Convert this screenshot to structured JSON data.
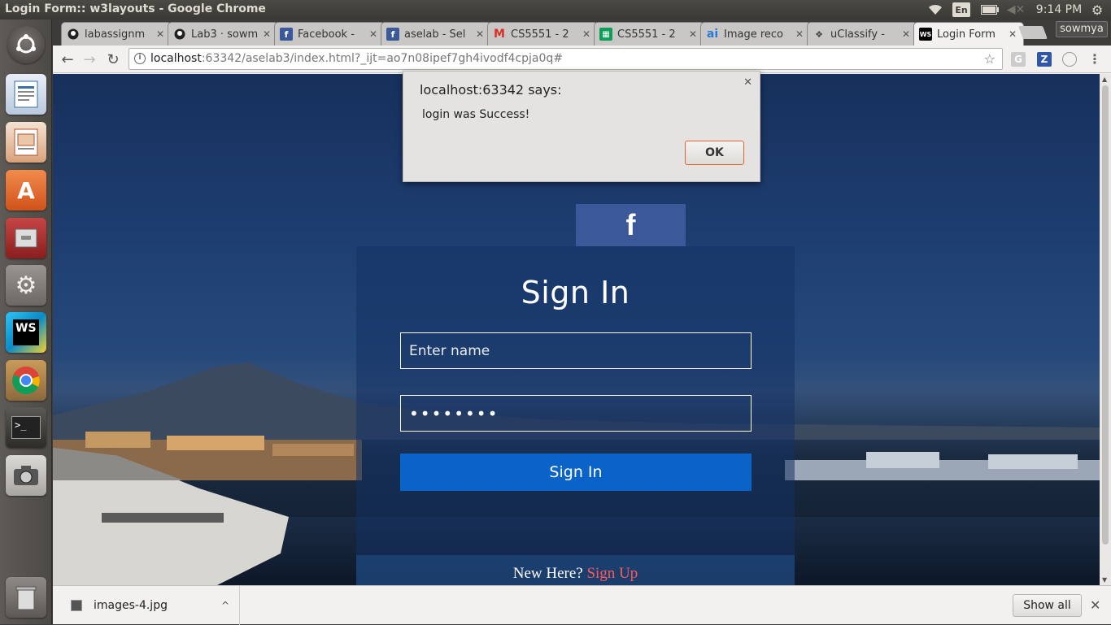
{
  "window": {
    "title": "Login Form:: w3layouts - Google Chrome"
  },
  "panel": {
    "lang": "En",
    "clock": "9:14 PM"
  },
  "tabs": [
    {
      "title": "labassignm",
      "favicon": "github-icon"
    },
    {
      "title": "Lab3 · sowm",
      "favicon": "github-icon"
    },
    {
      "title": "Facebook -",
      "favicon": "facebook-icon"
    },
    {
      "title": "aselab - Sel",
      "favicon": "facebook-icon"
    },
    {
      "title": "CS5551 - 2",
      "favicon": "gmail-icon"
    },
    {
      "title": "CS5551 - 2",
      "favicon": "sheets-icon"
    },
    {
      "title": "Image reco",
      "favicon": "ai-icon"
    },
    {
      "title": "uClassify -",
      "favicon": "uclassify-icon"
    },
    {
      "title": "Login Form",
      "favicon": "ws-icon"
    }
  ],
  "profile": {
    "name": "sowmya"
  },
  "address_bar": {
    "host": "localhost",
    "rest": ":63342/aselab3/index.html?_ijt=ao7n08ipef7gh4ivodf4cpja0q#"
  },
  "extensions": {
    "grammarly": "G",
    "zotero": "Z"
  },
  "page": {
    "facebook_glyph": "f",
    "heading": "Sign In",
    "name_placeholder": "Enter name",
    "password_mask": "••••••••",
    "signin_button": "Sign In",
    "new_here": "New Here?",
    "signup_link": "Sign Up"
  },
  "alert": {
    "title": "localhost:63342 says:",
    "message": "login was Success!",
    "ok_label": "OK"
  },
  "download_shelf": {
    "file_name": "images-4.jpg",
    "show_all": "Show all"
  },
  "colors": {
    "facebook_blue": "#3b5998",
    "signin_blue": "#0a63c9",
    "signup_red": "#ff5a5a",
    "ok_border": "#e46534"
  }
}
